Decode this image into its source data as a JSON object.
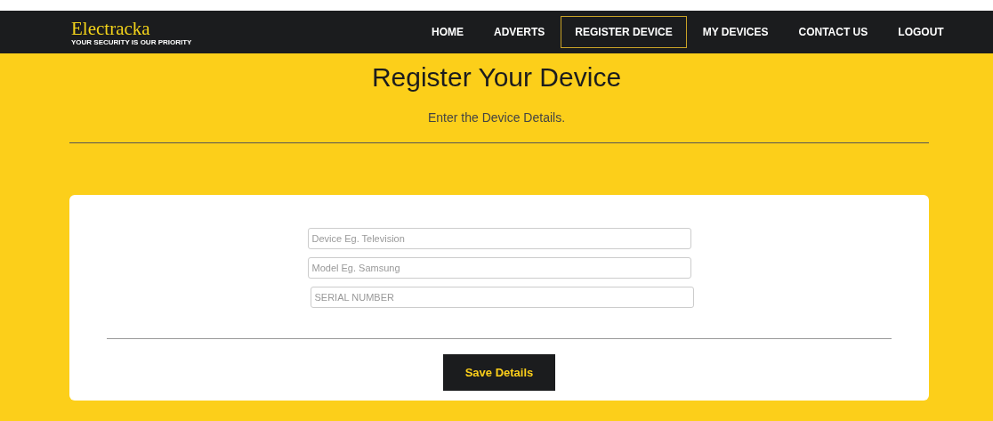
{
  "brand": {
    "name": "Electracka",
    "tagline": "YOUR SECURITY IS OUR PRIORITY"
  },
  "nav": [
    {
      "label": "HOME",
      "selected": false
    },
    {
      "label": "ADVERTS",
      "selected": false
    },
    {
      "label": "REGISTER DEVICE",
      "selected": true
    },
    {
      "label": "MY DEVICES",
      "selected": false
    },
    {
      "label": "CONTACT US",
      "selected": false
    },
    {
      "label": "LOGOUT",
      "selected": false
    }
  ],
  "heading": "Register Your Device",
  "subheading": "Enter the Device Details.",
  "fields": [
    {
      "placeholder": "Device Eg. Television"
    },
    {
      "placeholder": "Model Eg. Samsung"
    },
    {
      "placeholder": "SERIAL NUMBER"
    }
  ],
  "submit": "Save Details"
}
